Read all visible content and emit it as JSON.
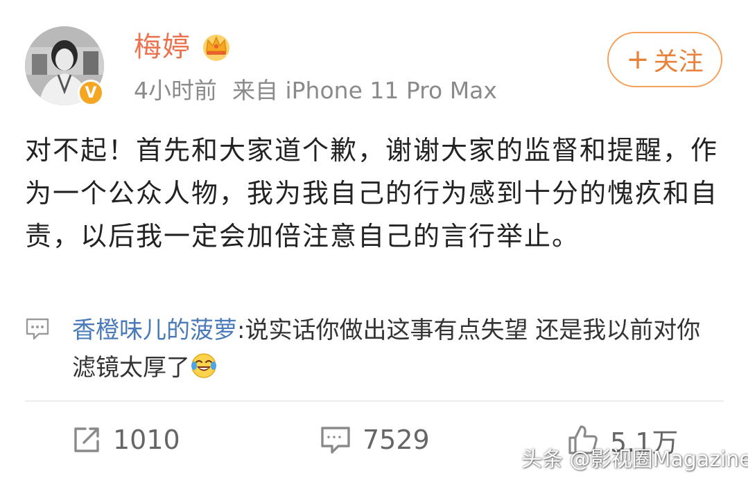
{
  "user": {
    "name": "梅婷",
    "verified_badge": "V",
    "time": "4小时前",
    "source": "来自 iPhone 11 Pro Max"
  },
  "follow": {
    "plus": "+",
    "label": "关注"
  },
  "post": {
    "text": "对不起！首先和大家道个歉，谢谢大家的监督和提醒，作为一个公众人物，我为我自己的行为感到十分的愧疚和自责，以后我一定会加倍注意自己的言行举止。"
  },
  "comment": {
    "author": "香橙味儿的菠萝",
    "text": ":说实话你做出这事有点失望 还是我以前对你滤镜太厚了"
  },
  "actions": {
    "reposts": "1010",
    "comments": "7529",
    "likes": "5.1万"
  },
  "watermark": "头条 @影视圈Magazine",
  "colors": {
    "username": "#eb7350",
    "follow_border": "#f5a05a",
    "comment_author": "#4a7ab8",
    "badge": "#f5a623"
  }
}
